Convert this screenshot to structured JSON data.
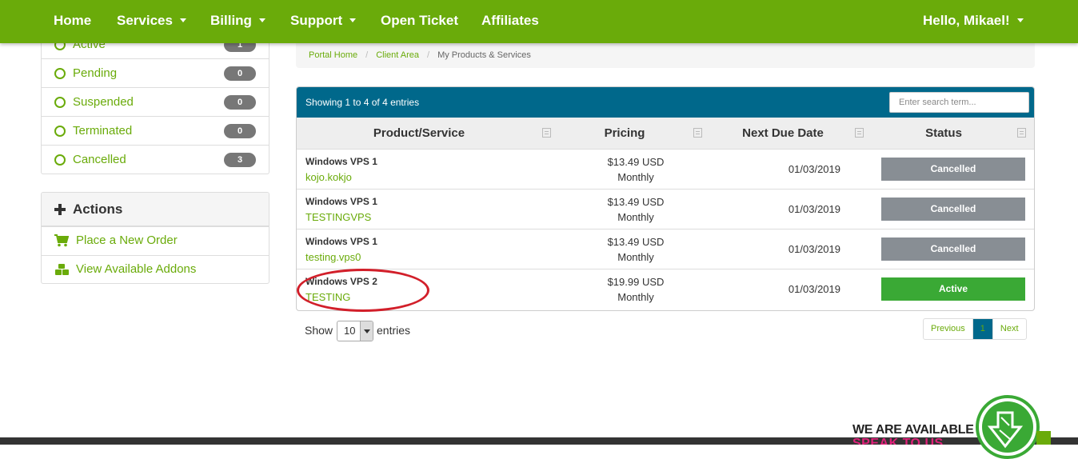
{
  "nav": {
    "items": [
      {
        "label": "Home",
        "has_caret": false
      },
      {
        "label": "Services",
        "has_caret": true
      },
      {
        "label": "Billing",
        "has_caret": true
      },
      {
        "label": "Support",
        "has_caret": true
      },
      {
        "label": "Open Ticket",
        "has_caret": false
      },
      {
        "label": "Affiliates",
        "has_caret": false
      }
    ],
    "user": "Hello, Mikael!"
  },
  "sidebar": {
    "statuses": [
      {
        "label": "Active",
        "count": "1"
      },
      {
        "label": "Pending",
        "count": "0"
      },
      {
        "label": "Suspended",
        "count": "0"
      },
      {
        "label": "Terminated",
        "count": "0"
      },
      {
        "label": "Cancelled",
        "count": "3"
      }
    ],
    "actions": {
      "title": "Actions",
      "items": [
        {
          "label": "Place a New Order",
          "icon": "shopping-cart-icon"
        },
        {
          "label": "View Available Addons",
          "icon": "cubes-icon"
        }
      ]
    }
  },
  "breadcrumb": {
    "items": [
      "Portal Home",
      "Client Area"
    ],
    "current": "My Products & Services"
  },
  "table": {
    "info": "Showing 1 to 4 of 4 entries",
    "search_placeholder": "Enter search term...",
    "columns": [
      "Product/Service",
      "Pricing",
      "Next Due Date",
      "Status"
    ],
    "rows": [
      {
        "product": "Windows VPS 1",
        "domain": "kojo.kokjo",
        "price": "$13.49 USD",
        "cycle": "Monthly",
        "due": "01/03/2019",
        "status": "Cancelled"
      },
      {
        "product": "Windows VPS 1",
        "domain": "TESTINGVPS",
        "price": "$13.49 USD",
        "cycle": "Monthly",
        "due": "01/03/2019",
        "status": "Cancelled"
      },
      {
        "product": "Windows VPS 1",
        "domain": "testing.vps0",
        "price": "$13.49 USD",
        "cycle": "Monthly",
        "due": "01/03/2019",
        "status": "Cancelled"
      },
      {
        "product": "Windows VPS 2",
        "domain": "TESTING",
        "price": "$19.99 USD",
        "cycle": "Monthly",
        "due": "01/03/2019",
        "status": "Active"
      }
    ],
    "status_colors": {
      "Cancelled": "#888e94",
      "Active": "#3aa935"
    },
    "length": {
      "show": "Show",
      "value": "10",
      "entries": "entries"
    },
    "pagination": {
      "previous": "Previous",
      "current": "1",
      "next": "Next"
    }
  },
  "footer": {
    "available": "WE ARE AVAILABLE",
    "speak": "SPEAK TO US"
  },
  "colors": {
    "brand_green": "#6aab0a",
    "header_blue": "#00688b",
    "annotation_red": "#d21f2a"
  }
}
